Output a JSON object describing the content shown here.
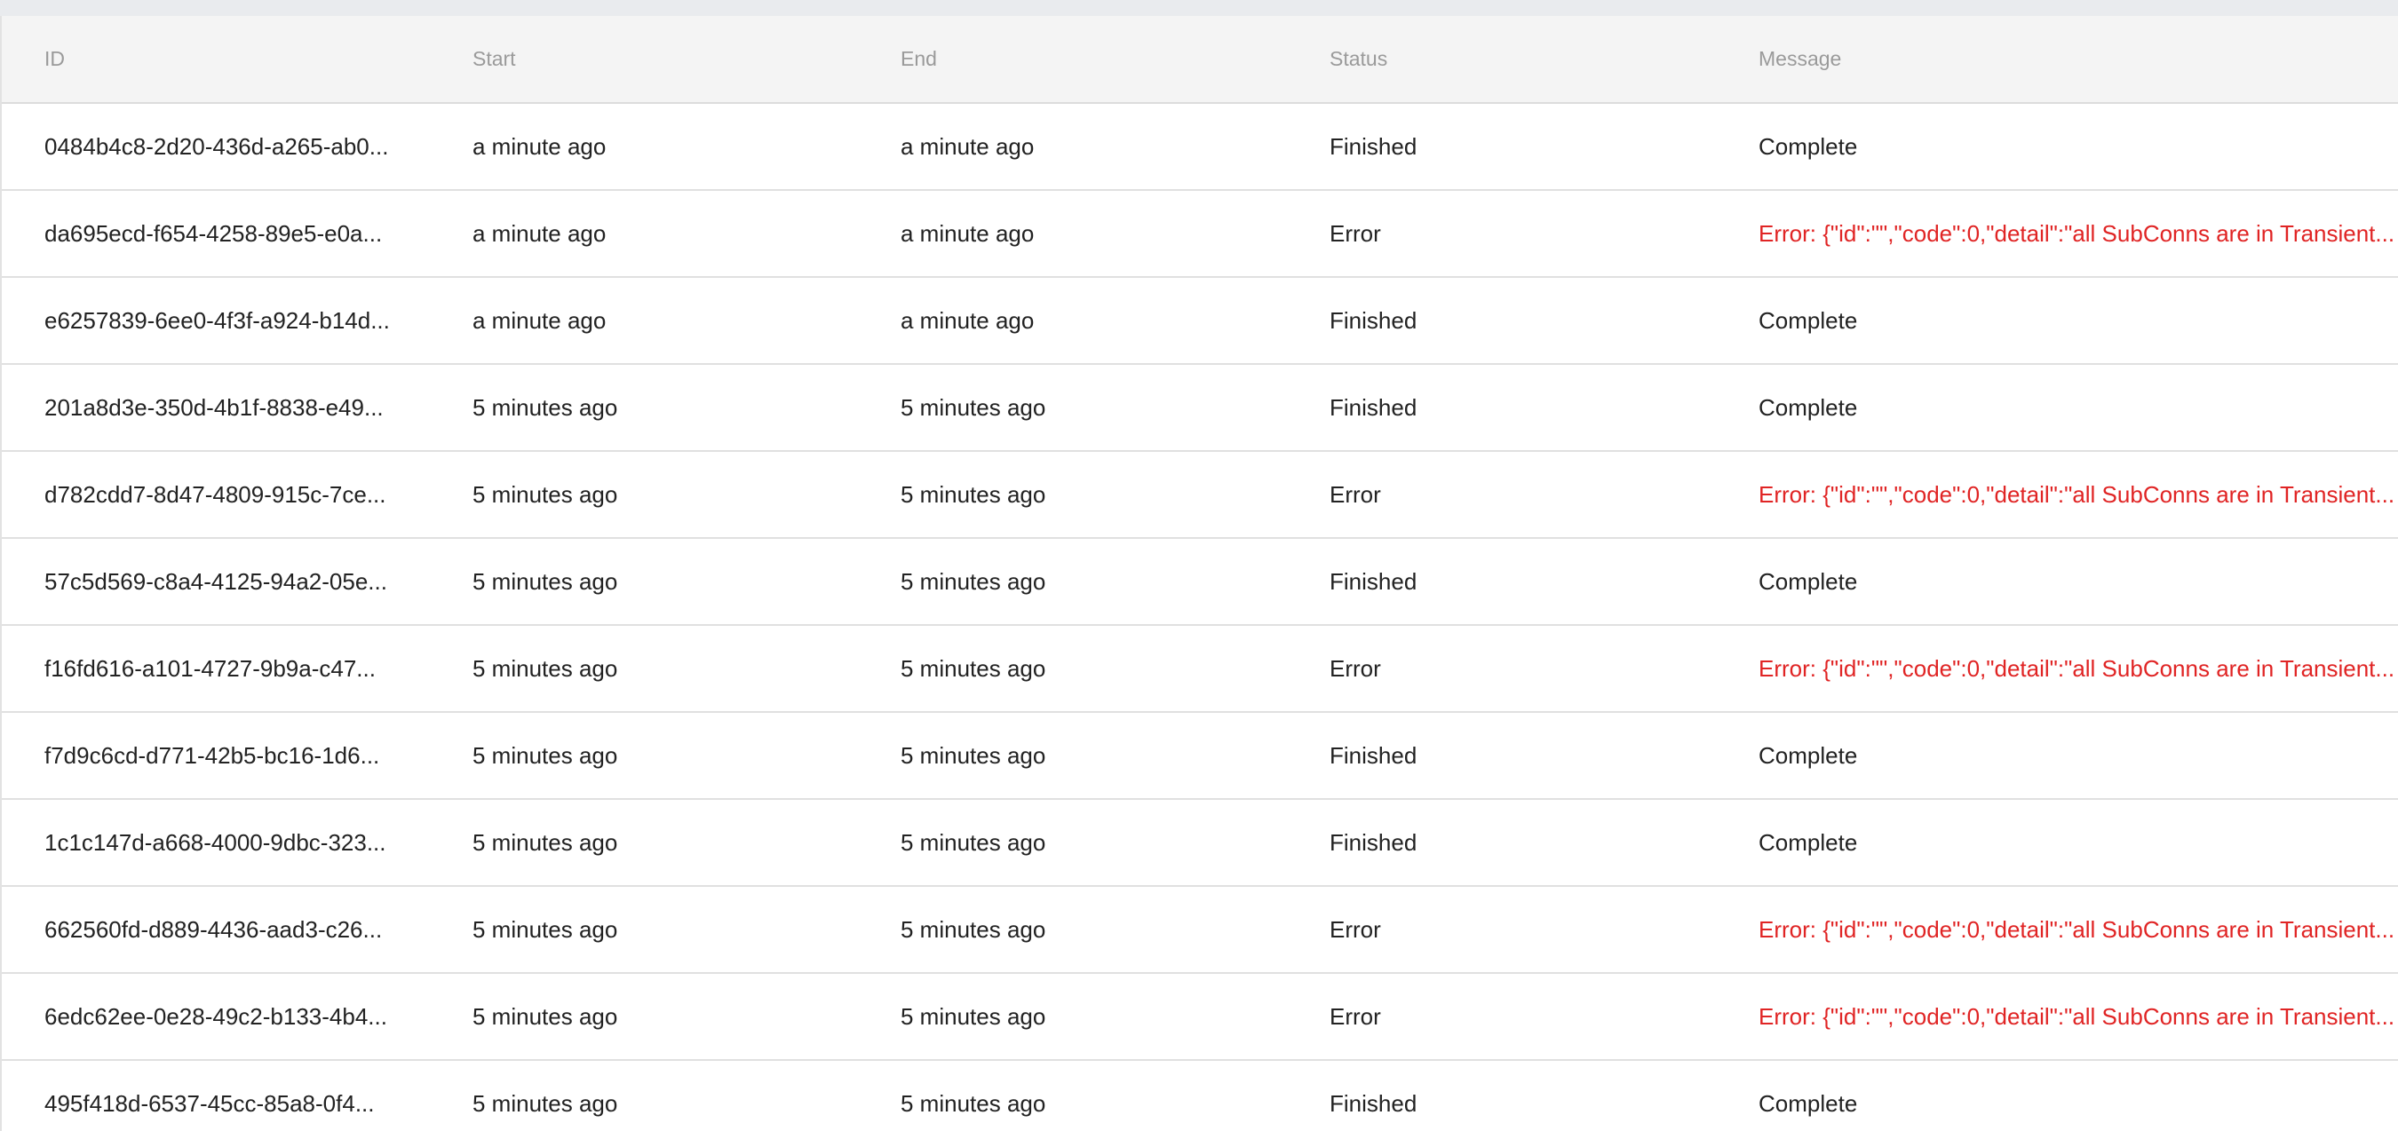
{
  "colors": {
    "error_text": "#e02424",
    "header_bg": "#f4f4f4",
    "header_text": "#9a9a9a"
  },
  "table": {
    "headers": [
      "ID",
      "Start",
      "End",
      "Status",
      "Message"
    ],
    "rows": [
      {
        "id": "0484b4c8-2d20-436d-a265-ab0...",
        "start": "a minute ago",
        "end": "a minute ago",
        "status": "Finished",
        "message": "Complete",
        "is_error": false
      },
      {
        "id": "da695ecd-f654-4258-89e5-e0a...",
        "start": "a minute ago",
        "end": "a minute ago",
        "status": "Error",
        "message": "Error: {\"id\":\"\",\"code\":0,\"detail\":\"all SubConns are in Transient...",
        "is_error": true
      },
      {
        "id": "e6257839-6ee0-4f3f-a924-b14d...",
        "start": "a minute ago",
        "end": "a minute ago",
        "status": "Finished",
        "message": "Complete",
        "is_error": false
      },
      {
        "id": "201a8d3e-350d-4b1f-8838-e49...",
        "start": "5 minutes ago",
        "end": "5 minutes ago",
        "status": "Finished",
        "message": "Complete",
        "is_error": false
      },
      {
        "id": "d782cdd7-8d47-4809-915c-7ce...",
        "start": "5 minutes ago",
        "end": "5 minutes ago",
        "status": "Error",
        "message": "Error: {\"id\":\"\",\"code\":0,\"detail\":\"all SubConns are in Transient...",
        "is_error": true
      },
      {
        "id": "57c5d569-c8a4-4125-94a2-05e...",
        "start": "5 minutes ago",
        "end": "5 minutes ago",
        "status": "Finished",
        "message": "Complete",
        "is_error": false
      },
      {
        "id": "f16fd616-a101-4727-9b9a-c47...",
        "start": "5 minutes ago",
        "end": "5 minutes ago",
        "status": "Error",
        "message": "Error: {\"id\":\"\",\"code\":0,\"detail\":\"all SubConns are in Transient...",
        "is_error": true
      },
      {
        "id": "f7d9c6cd-d771-42b5-bc16-1d6...",
        "start": "5 minutes ago",
        "end": "5 minutes ago",
        "status": "Finished",
        "message": "Complete",
        "is_error": false
      },
      {
        "id": "1c1c147d-a668-4000-9dbc-323...",
        "start": "5 minutes ago",
        "end": "5 minutes ago",
        "status": "Finished",
        "message": "Complete",
        "is_error": false
      },
      {
        "id": "662560fd-d889-4436-aad3-c26...",
        "start": "5 minutes ago",
        "end": "5 minutes ago",
        "status": "Error",
        "message": "Error: {\"id\":\"\",\"code\":0,\"detail\":\"all SubConns are in Transient...",
        "is_error": true
      },
      {
        "id": "6edc62ee-0e28-49c2-b133-4b4...",
        "start": "5 minutes ago",
        "end": "5 minutes ago",
        "status": "Error",
        "message": "Error: {\"id\":\"\",\"code\":0,\"detail\":\"all SubConns are in Transient...",
        "is_error": true
      },
      {
        "id": "495f418d-6537-45cc-85a8-0f4...",
        "start": "5 minutes ago",
        "end": "5 minutes ago",
        "status": "Finished",
        "message": "Complete",
        "is_error": false
      }
    ]
  }
}
